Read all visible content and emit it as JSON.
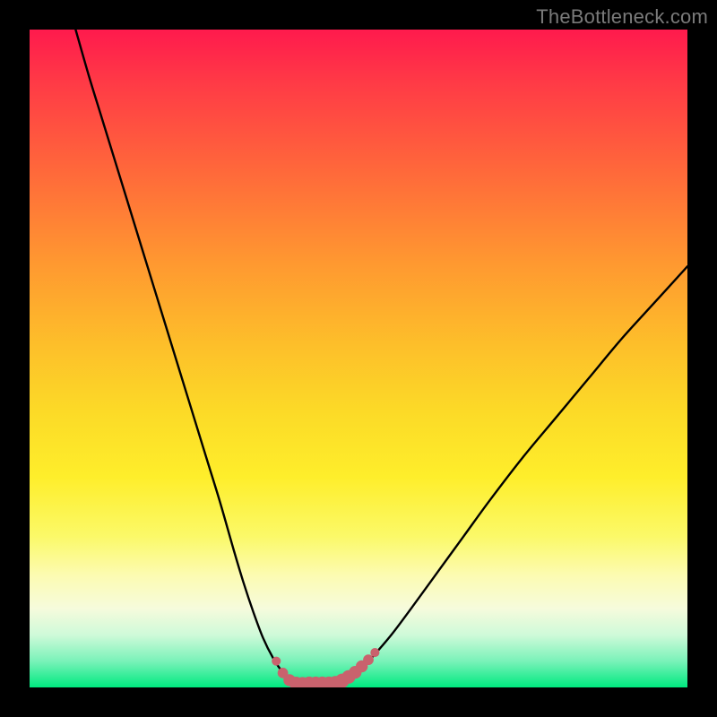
{
  "watermark": "TheBottleneck.com",
  "chart_data": {
    "type": "line",
    "title": "",
    "xlabel": "",
    "ylabel": "",
    "xlim": [
      0,
      100
    ],
    "ylim": [
      0,
      100
    ],
    "series": [
      {
        "name": "bottleneck-curve",
        "x": [
          7,
          9,
          11,
          13,
          15,
          17,
          19,
          21,
          23,
          25,
          27,
          29,
          31,
          32.5,
          34,
          35.5,
          37,
          38.5,
          40,
          41,
          42,
          44,
          46,
          48,
          50,
          52,
          55,
          58,
          62,
          66,
          70,
          75,
          80,
          85,
          90,
          95,
          100
        ],
        "y": [
          100,
          93,
          86.5,
          80,
          73.5,
          67,
          60.5,
          54,
          47.5,
          41,
          34.5,
          28,
          21,
          16,
          11.5,
          7.5,
          4.5,
          2.3,
          1.1,
          0.6,
          0.5,
          0.5,
          0.6,
          1.1,
          2.4,
          4.5,
          8,
          12,
          17.5,
          23,
          28.5,
          35,
          41,
          47,
          53,
          58.5,
          64
        ]
      }
    ],
    "markers": {
      "name": "highlight-dots",
      "color": "#c9626d",
      "points": [
        {
          "x": 37.5,
          "y": 4.0,
          "r": 1.2
        },
        {
          "x": 38.5,
          "y": 2.2,
          "r": 1.4
        },
        {
          "x": 39.5,
          "y": 1.1,
          "r": 1.6
        },
        {
          "x": 40.5,
          "y": 0.6,
          "r": 1.8
        },
        {
          "x": 41.5,
          "y": 0.5,
          "r": 1.9
        },
        {
          "x": 42.5,
          "y": 0.5,
          "r": 2.0
        },
        {
          "x": 43.5,
          "y": 0.5,
          "r": 2.0
        },
        {
          "x": 44.5,
          "y": 0.5,
          "r": 2.0
        },
        {
          "x": 45.5,
          "y": 0.5,
          "r": 2.0
        },
        {
          "x": 46.5,
          "y": 0.6,
          "r": 2.0
        },
        {
          "x": 47.5,
          "y": 1.0,
          "r": 1.9
        },
        {
          "x": 48.5,
          "y": 1.6,
          "r": 1.8
        },
        {
          "x": 49.5,
          "y": 2.3,
          "r": 1.7
        },
        {
          "x": 50.5,
          "y": 3.2,
          "r": 1.6
        },
        {
          "x": 51.5,
          "y": 4.2,
          "r": 1.4
        },
        {
          "x": 52.5,
          "y": 5.3,
          "r": 1.2
        }
      ]
    }
  }
}
